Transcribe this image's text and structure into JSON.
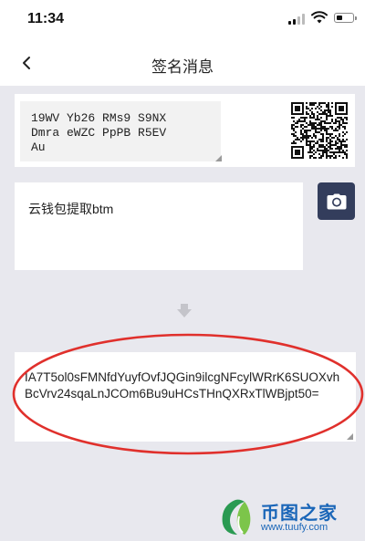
{
  "status_bar": {
    "time": "11:34",
    "icons": [
      "cellular-signal-icon",
      "wifi-icon",
      "battery-icon"
    ]
  },
  "nav": {
    "title": "签名消息",
    "back_icon": "chevron-left-icon"
  },
  "address": {
    "value": "19WV Yb26 RMs9 S9NX\nDmra eWZC PpPB R5EV\nAu",
    "qr_icon": "qr-code-icon"
  },
  "message": {
    "value": "云钱包提取btm",
    "camera_icon": "camera-icon"
  },
  "arrow_icon": "arrow-down-icon",
  "signature": {
    "value": "IA7T5ol0sFMNfdYuyfOvfJQGin9ilcgNFcylWRrK6SUOXvhBcVrv24sqaLnJCOm6Bu9uHCsTHnQXRxTlWBjpt50="
  },
  "colors": {
    "page_background": "#e8e8ee",
    "camera_button": "#333d5c",
    "annotation_circle": "#e0302c",
    "watermark_text": "#1a66b8"
  },
  "watermark": {
    "title": "币图之家",
    "url": "www.tuufy.com"
  }
}
